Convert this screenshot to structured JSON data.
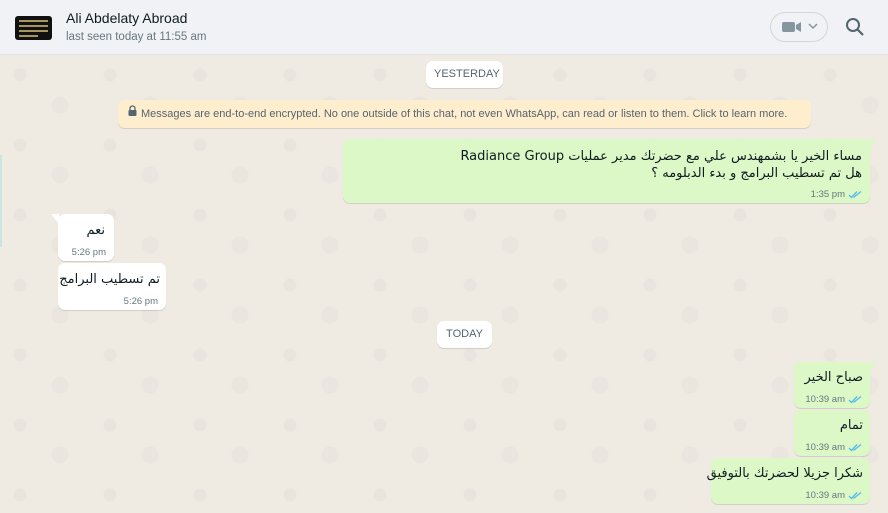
{
  "header": {
    "contact_name": "Ali Abdelaty Abroad",
    "last_seen": "last seen today at 11:55 am",
    "avatar_icon": "contact-avatar",
    "video_icon": "video-camera-icon",
    "search_icon": "search-icon"
  },
  "chat": {
    "date_yesterday": "YESTERDAY",
    "date_today": "TODAY",
    "encryption_notice": "Messages are end-to-end encrypted. No one outside of this chat, not even WhatsApp, can read or listen to them. Click to learn more.",
    "messages": [
      {
        "direction": "out",
        "line1": "مساء الخير يا بشمهندس علي  مع حضرتك مدير عمليات Radiance Group",
        "line2": "هل تم تسطيب البرامج و بدء الدبلومه ؟",
        "time": "1:35 pm",
        "status": "read"
      },
      {
        "direction": "in",
        "text": "نعم",
        "time": "5:26 pm"
      },
      {
        "direction": "in",
        "text": "تم تسطيب البرامج",
        "time": "5:26 pm"
      },
      {
        "direction": "out",
        "text": "صباح الخير",
        "time": "10:39 am",
        "status": "read"
      },
      {
        "direction": "out",
        "text": "تمام",
        "time": "10:39 am",
        "status": "read"
      },
      {
        "direction": "out",
        "text": "شكرا جزيلا لحضرتك بالتوفيق",
        "time": "10:39 am",
        "status": "read"
      }
    ]
  },
  "colors": {
    "outgoing_bubble": "#dcf8c6",
    "incoming_bubble": "#ffffff",
    "read_ticks": "#53bdeb",
    "chat_background": "#efeae2",
    "encryption_banner": "#ffeecd"
  }
}
